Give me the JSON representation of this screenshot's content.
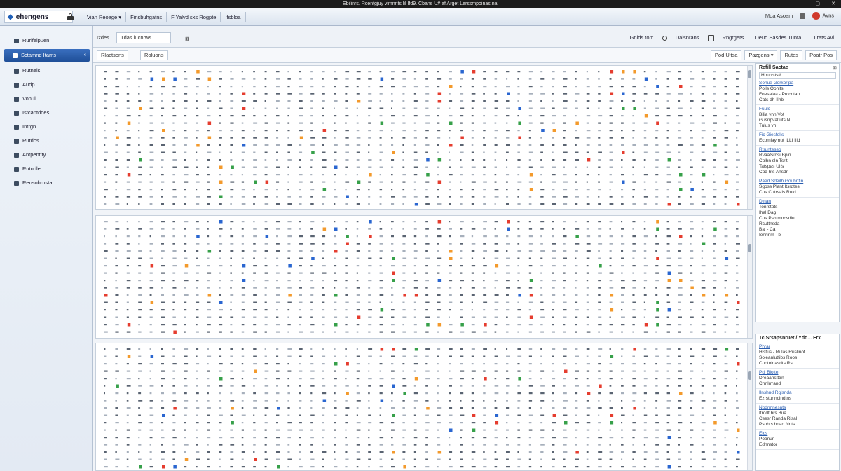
{
  "window": {
    "title": "Ebilinrs. Rcentgjuy vimnnts lil Ifd9. Cbans U# af Arget Lerssmpoinas.nai",
    "controls": [
      "—",
      "▢",
      "✕"
    ]
  },
  "topbar": {
    "logo_text": "ehengens",
    "menu": [
      "Vian Reoage ▾",
      "Finsbuhgatns",
      "F Yalvd sxs Rogpte",
      "Ifsbloa"
    ],
    "right": {
      "user": "Moa Asoam",
      "account": "Avns"
    }
  },
  "sidebar": {
    "items": [
      {
        "label": "Rurlfeipuen",
        "active": false
      },
      {
        "label": "Sctamnd Itams",
        "active": true
      },
      {
        "label": "Rutnels",
        "active": false
      },
      {
        "label": "Audp",
        "active": false
      },
      {
        "label": "Vonul",
        "active": false
      },
      {
        "label": "Istcantdoes",
        "active": false
      },
      {
        "label": "Intrgn",
        "active": false
      },
      {
        "label": "Rutdos",
        "active": false
      },
      {
        "label": "Antpentity",
        "active": false
      },
      {
        "label": "Rutodle",
        "active": false
      },
      {
        "label": "Rensobrnsta",
        "active": false
      }
    ]
  },
  "toolbar": {
    "label": "Izdes",
    "tab": "Tdas lucnrws",
    "right_buttons": [
      "Gnids ton:",
      "Dalsnrans",
      "Rngrgers",
      "Deud Sasdes Tunta."
    ],
    "account_link": "Lrats Avi"
  },
  "filters": {
    "left": [
      "Rlactsons",
      "Roluons"
    ],
    "right": [
      "Pod Uitsa",
      "Pazgens ▾",
      "Rutes",
      "Poatr Pos"
    ]
  },
  "right_panel": {
    "card1": {
      "title": "Refill Sactae",
      "search": "Hourrsts#",
      "entries": [
        {
          "link": "Sonue Gorkorlpa",
          "lines": [
            "Poils Oonitsl",
            "Foesalaa - Prccntan",
            "Cats dh IIhb"
          ]
        },
        {
          "link": "Fuulc",
          "lines": [
            "Bilia vnn Vot",
            "Gusnpvaltuts.N",
            "Tulus vh"
          ]
        },
        {
          "link": "Fic Giesfolis",
          "lines": [
            "Ecpmlaymut ILLI Iild"
          ]
        },
        {
          "link": "Rtruntesso",
          "lines": [
            "Rvaafsrnsi Bpin",
            "Cplhn sln Tsrlt",
            "Tatspas Ulfs",
            "Cpd hts Ansdr"
          ]
        },
        {
          "link": "Paed Sdeilh Gouhnfin",
          "lines": [
            "Sgoss Plant Itsrdtes",
            "Cus Cutrsals Rutd"
          ]
        },
        {
          "link": "Dinan",
          "lines": [
            "Tonrstpts",
            "Ihal Dag",
            "Cus Pshtmocsdlu",
            "Rcuttnsda",
            "Bal - Ca",
            "Ienrinm Tb"
          ]
        }
      ]
    },
    "card2": {
      "title": "Tc Srsapsnruet / Ydd... Frx",
      "entries": [
        {
          "link": "Phrar",
          "lines": [
            "Hlstus - Rulas Ruslinof",
            "Soleanlutfibs Roos",
            "Cuotolnasdts Rs"
          ]
        },
        {
          "link": "Pdi Blolte",
          "lines": [
            "Dreaanstttrn",
            "Crmlrrrand"
          ]
        },
        {
          "link": "Ilnshnd Rglsnda",
          "lines": [
            "Ezrstunnclndtns"
          ]
        },
        {
          "link": "Nodnnnesnts",
          "lines": [
            "Itrodt brs Bua",
            "Csesr Randa Risal",
            "Psohts hnad Nnts"
          ]
        },
        {
          "link": "Elcs",
          "lines": [
            "Poanun",
            "Ednnstor"
          ]
        }
      ]
    }
  },
  "grid": {
    "columns": 56,
    "rows_per_band": 19,
    "bands": 3
  },
  "colors": {
    "accent": "#1f4f98",
    "marker_red": "#e53d2f",
    "marker_orange": "#f39a2c",
    "marker_blue": "#2a66d0",
    "marker_green": "#37a04a"
  }
}
